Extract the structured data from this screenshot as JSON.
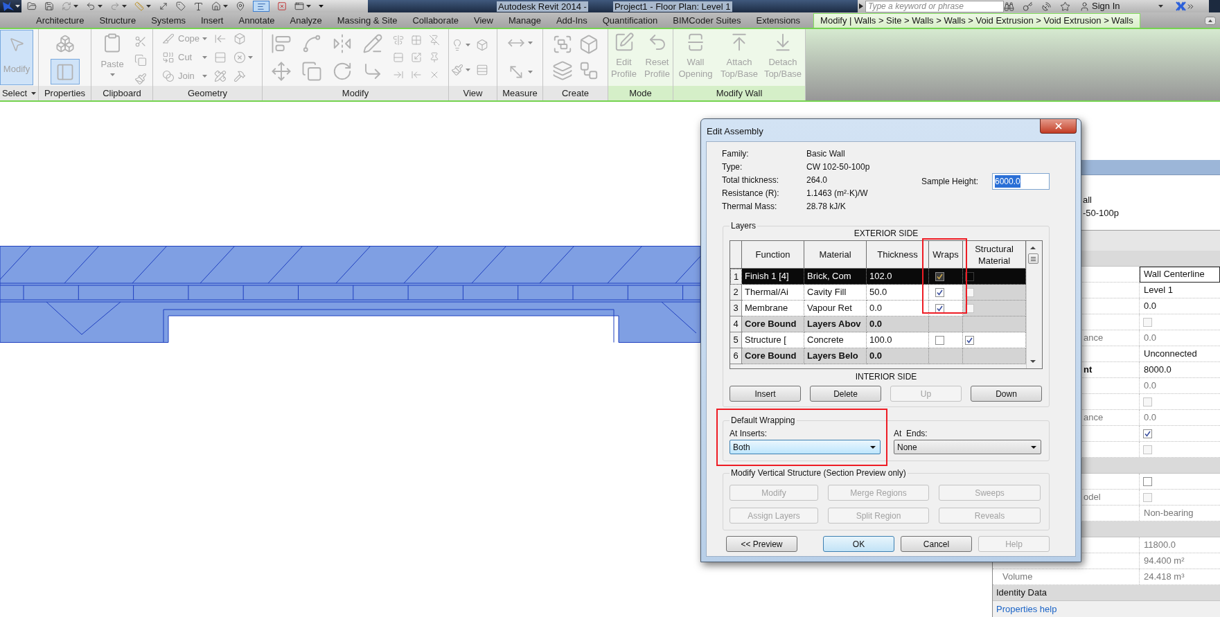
{
  "title_bar": {
    "app": "Autodesk Revit 2014 -",
    "document": "Project1 - Floor Plan: Level 1",
    "search": {
      "placeholder": "Type a keyword or phrase"
    },
    "sign_in": "Sign In"
  },
  "quick_access_toggle": {
    "on": true
  },
  "ribbon_tabs": [
    {
      "label": "Architecture",
      "selected": false
    },
    {
      "label": "Structure",
      "selected": false
    },
    {
      "label": "Systems",
      "selected": false
    },
    {
      "label": "Insert",
      "selected": false
    },
    {
      "label": "Annotate",
      "selected": false
    },
    {
      "label": "Analyze",
      "selected": false
    },
    {
      "label": "Massing & Site",
      "selected": false
    },
    {
      "label": "Collaborate",
      "selected": false
    },
    {
      "label": "View",
      "selected": false
    },
    {
      "label": "Manage",
      "selected": false
    },
    {
      "label": "Add-Ins",
      "selected": false
    },
    {
      "label": "Quantification",
      "selected": false
    },
    {
      "label": "BIMCoder Suites",
      "selected": false
    },
    {
      "label": "Extensions",
      "selected": false
    },
    {
      "label": "Modify | Walls > Site > Walls > Walls > Void Extrusion > Void Extrusion > Walls",
      "selected": true
    }
  ],
  "ribbon_panels": [
    {
      "kind": "select",
      "label": "Select",
      "contextual": false,
      "buttons": [
        {
          "label": "Modify",
          "selected": true,
          "disabled": true
        }
      ]
    },
    {
      "kind": "properties",
      "label": "Properties",
      "contextual": false,
      "buttons": [
        {
          "on": false
        },
        {
          "on": true
        }
      ]
    },
    {
      "kind": "clipboard",
      "label": "Clipboard",
      "contextual": false,
      "buttons": [
        {
          "label": "Paste",
          "disabled": true
        }
      ]
    },
    {
      "kind": "geometry",
      "label": "Geometry",
      "contextual": false,
      "buttons": [
        {
          "label": "Cope",
          "disabled": true
        },
        {
          "label": "Cut",
          "disabled": true
        },
        {
          "label": "Join",
          "disabled": true
        }
      ]
    },
    {
      "kind": "modify",
      "label": "Modify",
      "contextual": false
    },
    {
      "kind": "view",
      "label": "View",
      "contextual": false
    },
    {
      "kind": "measure",
      "label": "Measure",
      "contextual": false
    },
    {
      "kind": "create",
      "label": "Create",
      "contextual": false
    },
    {
      "kind": "mode",
      "label": "Mode",
      "contextual": true,
      "buttons": [
        {
          "label": "Edit Profile",
          "disabled": true
        },
        {
          "label": "Reset Profile",
          "disabled": true
        }
      ]
    },
    {
      "kind": "modify-wall",
      "label": "Modify Wall",
      "contextual": true,
      "buttons": [
        {
          "label": "Wall Opening",
          "disabled": true
        },
        {
          "label": "Attach Top/Base",
          "disabled": true
        },
        {
          "label": "Detach Top/Base",
          "disabled": true
        }
      ]
    }
  ],
  "properties_palette": {
    "type_selector": {
      "family": "all",
      "type": "-50-100p"
    },
    "rows": [
      {
        "kind": "group"
      },
      {
        "kind": "field",
        "value": "Wall Centerline"
      },
      {
        "kind": "text",
        "value": "Level 1",
        "disabled": false
      },
      {
        "kind": "text",
        "value": "0.0",
        "disabled": false
      },
      {
        "kind": "checkbox",
        "checked": false,
        "disabled": true
      },
      {
        "kind": "text",
        "label": "ance",
        "bold": false,
        "value": "0.0",
        "disabled": true
      },
      {
        "kind": "text",
        "value": "Unconnected",
        "disabled": false
      },
      {
        "kind": "text",
        "label": "nt",
        "bold": true,
        "value": "8000.0",
        "disabled": false
      },
      {
        "kind": "text",
        "value": "0.0",
        "disabled": true
      },
      {
        "kind": "checkbox",
        "checked": false,
        "disabled": true
      },
      {
        "kind": "text",
        "label": "ance",
        "bold": false,
        "value": "0.0",
        "disabled": true
      },
      {
        "kind": "checkbox",
        "checked": true,
        "disabled": false
      },
      {
        "kind": "checkbox",
        "checked": false,
        "disabled": true
      },
      {
        "kind": "group"
      },
      {
        "kind": "checkbox",
        "checked": false,
        "disabled": false
      },
      {
        "kind": "checkbox",
        "label": "odel",
        "bold": false,
        "checked": false,
        "disabled": true
      },
      {
        "kind": "text",
        "value": "Non-bearing",
        "disabled": true
      },
      {
        "kind": "group"
      },
      {
        "kind": "text",
        "value": "11800.0",
        "disabled": true
      },
      {
        "kind": "text",
        "value": "94.400 m²",
        "disabled": true
      },
      {
        "kind": "text",
        "label": "Volume",
        "bold": false,
        "value": "24.418 m³",
        "disabled": true
      },
      {
        "kind": "group",
        "label": "Identity Data"
      }
    ],
    "help_link": "Properties help"
  },
  "dialog": {
    "title": "Edit Assembly",
    "info": [
      {
        "label": "Family:",
        "value": "Basic Wall"
      },
      {
        "label": "Type:",
        "value": "CW 102-50-100p"
      },
      {
        "label": "Total thickness:",
        "value": "264.0"
      },
      {
        "label": "Resistance (R):",
        "value": "1.1463 (m²·K)/W"
      },
      {
        "label": "Thermal Mass:",
        "value": "28.78 kJ/K"
      }
    ],
    "sample_height": {
      "label": "Sample Height:",
      "value": "6000.0",
      "text_selected": true
    },
    "layers": {
      "title": "Layers",
      "exterior_label": "EXTERIOR SIDE",
      "interior_label": "INTERIOR SIDE",
      "columns": [
        "Function",
        "Material",
        "Thickness",
        "Wraps",
        "Structural Material"
      ],
      "rows": [
        {
          "number": "1",
          "kind": "layer",
          "selected": true,
          "function": "Finish 1 [4]",
          "material": "Brick, Com",
          "thickness": "102.0",
          "wraps": {
            "checked": true,
            "disabled": false
          },
          "structural_material": {
            "checked": false,
            "disabled": true
          }
        },
        {
          "number": "2",
          "kind": "layer",
          "selected": false,
          "function": "Thermal/Ai",
          "material": "Cavity Fill",
          "thickness": "50.0",
          "wraps": {
            "checked": true,
            "disabled": false
          },
          "structural_material": {
            "checked": false,
            "disabled": true
          }
        },
        {
          "number": "3",
          "kind": "layer",
          "selected": false,
          "function": "Membrane",
          "material": "Vapour Ret",
          "thickness": "0.0",
          "wraps": {
            "checked": true,
            "disabled": false
          },
          "structural_material": {
            "checked": false,
            "disabled": true
          }
        },
        {
          "number": "4",
          "kind": "boundary",
          "selected": false,
          "function": "Core Bound",
          "material": "Layers Abov",
          "thickness": "0.0"
        },
        {
          "number": "5",
          "kind": "layer",
          "selected": false,
          "function": "Structure [",
          "material": "Concrete",
          "thickness": "100.0",
          "wraps": {
            "checked": false,
            "disabled": false
          },
          "structural_material": {
            "checked": true,
            "disabled": false
          }
        },
        {
          "number": "6",
          "kind": "boundary",
          "selected": false,
          "function": "Core Bound",
          "material": "Layers Belo",
          "thickness": "0.0"
        }
      ],
      "buttons": [
        {
          "label": "Insert",
          "disabled": false
        },
        {
          "label": "Delete",
          "disabled": false
        },
        {
          "label": "Up",
          "disabled": true
        },
        {
          "label": "Down",
          "disabled": false
        }
      ]
    },
    "default_wrapping": {
      "title": "Default Wrapping",
      "at_inserts": {
        "label": "At Inserts:",
        "value": "Both",
        "focused": true
      },
      "at_ends": {
        "label": "At  Ends:",
        "value": "None",
        "focused": false
      }
    },
    "vertical_structure": {
      "title": "Modify Vertical Structure (Section Preview only)",
      "buttons": [
        {
          "label": "Modify",
          "disabled": true
        },
        {
          "label": "Merge Regions",
          "disabled": true
        },
        {
          "label": "Sweeps",
          "disabled": true
        },
        {
          "label": "Assign Layers",
          "disabled": true
        },
        {
          "label": "Split Region",
          "disabled": true
        },
        {
          "label": "Reveals",
          "disabled": true
        }
      ]
    },
    "footer_buttons": [
      {
        "label": "<< Preview",
        "disabled": false,
        "default": false
      },
      {
        "label": "OK",
        "disabled": false,
        "default": true
      },
      {
        "label": "Cancel",
        "disabled": false,
        "default": false
      },
      {
        "label": "Help",
        "disabled": true,
        "default": false
      }
    ]
  }
}
